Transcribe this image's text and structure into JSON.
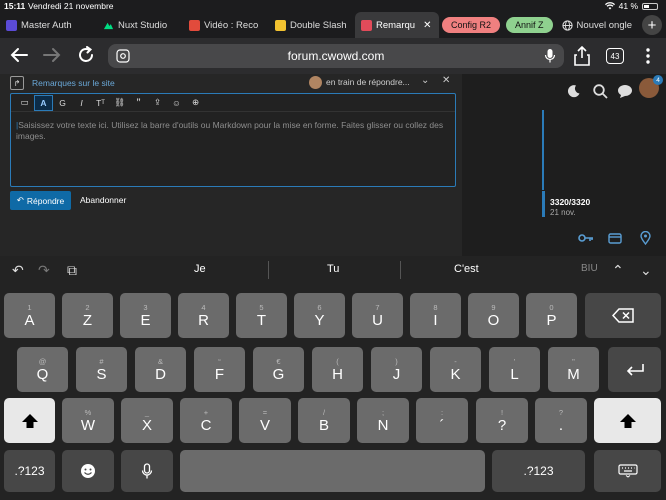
{
  "status": {
    "time": "15:11",
    "date": "Vendredi 21 novembre",
    "battery": "41 %"
  },
  "tabs": [
    {
      "title": "Master Auth",
      "fav_color": "#5b4bd6"
    },
    {
      "title": "Nuxt Studio",
      "fav_color": "#1a1a1a"
    },
    {
      "title": "Vidéo : Reco",
      "fav_color": "#e24b3c"
    },
    {
      "title": "Double Slash",
      "fav_color": "#f2c230"
    },
    {
      "title": "Remarqu",
      "fav_color": "#e24b5a",
      "active": true
    }
  ],
  "tab_groups": [
    {
      "label": "Config R2",
      "color": "#f08080"
    },
    {
      "label": "Annif Z",
      "color": "#8fd18f"
    }
  ],
  "extra_tab": {
    "title": "Nouvel ongle"
  },
  "address_bar": {
    "url": "forum.cwowd.com"
  },
  "tabs_count": "43",
  "composer": {
    "topic_title": "Remarques sur le site",
    "status_text": "en train de répondre...",
    "placeholder": "Saisissez votre texte ici. Utilisez la barre d'outils ou Markdown pour la mise en forme. Faites glisser ou collez des images.",
    "submit_label": "Répondre",
    "cancel_label": "Abandonner",
    "toolbar_items": [
      "toggle-icon",
      "A",
      "G",
      "I",
      "Tᵀ",
      "link-icon",
      "”",
      "upload-icon",
      "emoji-icon",
      "add-icon"
    ]
  },
  "timeline": {
    "count": "3320/3320",
    "date": "21 nov."
  },
  "header_badge": "4",
  "keyboard": {
    "suggestions": [
      "Je",
      "Tu",
      "C'est"
    ],
    "biu": "BIU",
    "row1": [
      {
        "alt": "1",
        "main": "A"
      },
      {
        "alt": "2",
        "main": "Z"
      },
      {
        "alt": "3",
        "main": "E"
      },
      {
        "alt": "4",
        "main": "R"
      },
      {
        "alt": "5",
        "main": "T"
      },
      {
        "alt": "6",
        "main": "Y"
      },
      {
        "alt": "7",
        "main": "U"
      },
      {
        "alt": "8",
        "main": "I"
      },
      {
        "alt": "9",
        "main": "O"
      },
      {
        "alt": "0",
        "main": "P"
      }
    ],
    "row2": [
      {
        "alt": "@",
        "main": "Q"
      },
      {
        "alt": "#",
        "main": "S"
      },
      {
        "alt": "&",
        "main": "D"
      },
      {
        "alt": "“",
        "main": "F"
      },
      {
        "alt": "€",
        "main": "G"
      },
      {
        "alt": "(",
        "main": "H"
      },
      {
        "alt": ")",
        "main": "J"
      },
      {
        "alt": "-",
        "main": "K"
      },
      {
        "alt": "'",
        "main": "L"
      },
      {
        "alt": "\"",
        "main": "M"
      }
    ],
    "row3": [
      {
        "alt": "%",
        "main": "W"
      },
      {
        "alt": "_",
        "main": "X"
      },
      {
        "alt": "+",
        "main": "C"
      },
      {
        "alt": "=",
        "main": "V"
      },
      {
        "alt": "/",
        "main": "B"
      },
      {
        "alt": ";",
        "main": "N"
      },
      {
        "alt": ":",
        "main": "´"
      },
      {
        "alt": "!",
        "main": "?"
      },
      {
        "alt": "?",
        "main": "."
      }
    ],
    "numbers_label": ".?123"
  },
  "colors": {
    "accent": "#2b7bb8",
    "submit": "#0f6aa6",
    "key": "#6b6b6b",
    "key_fn": "#474747"
  }
}
